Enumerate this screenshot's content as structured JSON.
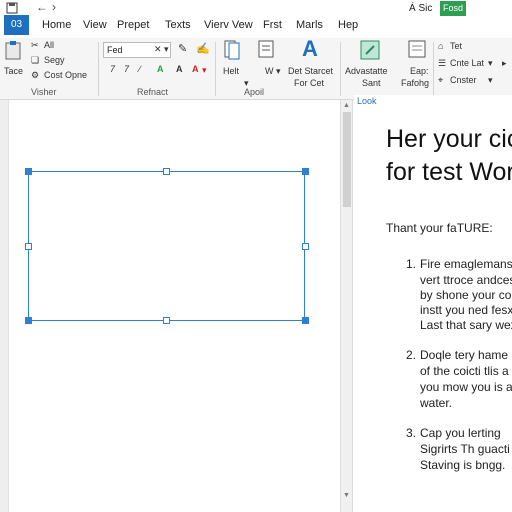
{
  "title_bar": {
    "user_text": "Á Sic",
    "badge_label": "Fosd"
  },
  "file_tab": "03",
  "menu": [
    "Home",
    "View",
    "Prepet",
    "Texts",
    "Vierv Vew",
    "Frst",
    "Marls",
    "Hep"
  ],
  "ribbon": {
    "clipboard": {
      "paste_label": "Tace",
      "items": [
        "All",
        "Segy",
        "Cost Opne"
      ],
      "group_label": "Visher"
    },
    "font": {
      "font_box_value": "Fed",
      "format_items": [
        "7",
        "7",
        "A",
        "A",
        "A"
      ],
      "group_label": "Refnact"
    },
    "april": {
      "items": [
        "Helt",
        "W",
        "Det Starcet",
        "For Cet"
      ],
      "group_label": "Apoil"
    },
    "big_a_label": "A",
    "styles": {
      "items": [
        "Advastatte",
        "Sant",
        "Eap:",
        "Fafohg"
      ]
    },
    "right_group": {
      "items": [
        "Tet",
        "Cnte Lat",
        "Cnster"
      ]
    }
  },
  "pane": {
    "tab_label": "Look"
  },
  "document": {
    "heading_line1": "Her your cic",
    "heading_line2": "for test Worr",
    "intro": "Thant your faTURE:",
    "list": [
      {
        "num": "1.",
        "lines": [
          "Fire emaglemans w",
          "vert ttroce andcest",
          "by shone your conn",
          "instt you ned fesx",
          "Last that sary wex"
        ]
      },
      {
        "num": "2.",
        "lines": [
          "Doqle tery hame",
          "of the coicti tlis a",
          "you mow you is a",
          "water."
        ]
      },
      {
        "num": "3.",
        "lines": [
          "Cap you lerting",
          "Sigrirts Th guacti",
          "Staving is bngg."
        ]
      }
    ]
  },
  "colors": {
    "file_tab": "#1f6fc1",
    "badge": "#2e9e55",
    "selection": "#2f7fd2",
    "font_color_red": "#d22020",
    "highlight_green": "#2a9a4a"
  }
}
